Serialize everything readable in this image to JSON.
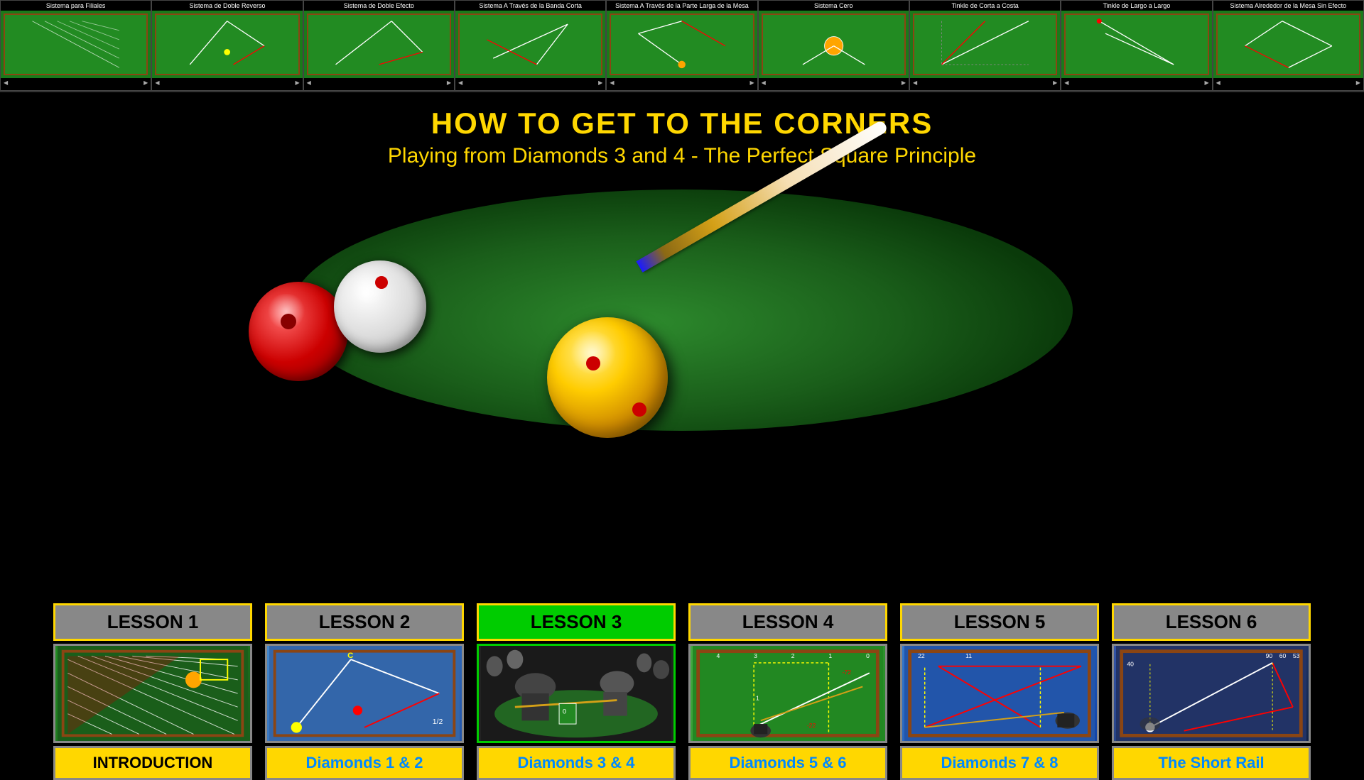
{
  "thumbnails": [
    {
      "title": "Sistema para Filiales",
      "nav_left": "◀",
      "nav_right": "▶"
    },
    {
      "title": "Sistema de Doble Reverso",
      "nav_left": "◀",
      "nav_right": "▶"
    },
    {
      "title": "Sistema de Doble Efecto",
      "nav_left": "◀",
      "nav_right": "▶"
    },
    {
      "title": "Sistema A Través de la Banda Corta",
      "nav_left": "◀",
      "nav_right": "▶"
    },
    {
      "title": "Sistema A Través de la Parte Larga de la Mesa",
      "nav_left": "◀",
      "nav_right": "▶"
    },
    {
      "title": "Sistema Cero",
      "nav_left": "◀",
      "nav_right": "▶"
    },
    {
      "title": "Tinkle de Corta a Costa",
      "nav_left": "◀",
      "nav_right": "▶"
    },
    {
      "title": "Tinkle de Largo a Largo",
      "nav_left": "◀",
      "nav_right": "▶"
    },
    {
      "title": "Sistema Alrededor de la Mesa Sin Efecto",
      "nav_left": "◀",
      "nav_right": "▶"
    }
  ],
  "main_title": "HOW TO GET TO THE CORNERS",
  "sub_title": "Playing from Diamonds 3 and 4 - The Perfect Square Principle",
  "lessons": [
    {
      "label": "LESSON 1",
      "caption": "INTRODUCTION",
      "caption_style": "yellow",
      "active": false
    },
    {
      "label": "LESSON 2",
      "caption": "Diamonds 1 & 2",
      "caption_style": "cyan",
      "active": false
    },
    {
      "label": "LESSON 3",
      "caption": "Diamonds 3 & 4",
      "caption_style": "cyan",
      "active": true
    },
    {
      "label": "LESSON 4",
      "caption": "Diamonds 5 & 6",
      "caption_style": "cyan",
      "active": false
    },
    {
      "label": "LESSON 5",
      "caption": "Diamonds 7 & 8",
      "caption_style": "cyan",
      "active": false
    },
    {
      "label": "LESSON 6",
      "caption": "The Short Rail",
      "caption_style": "cyan",
      "active": false
    }
  ]
}
